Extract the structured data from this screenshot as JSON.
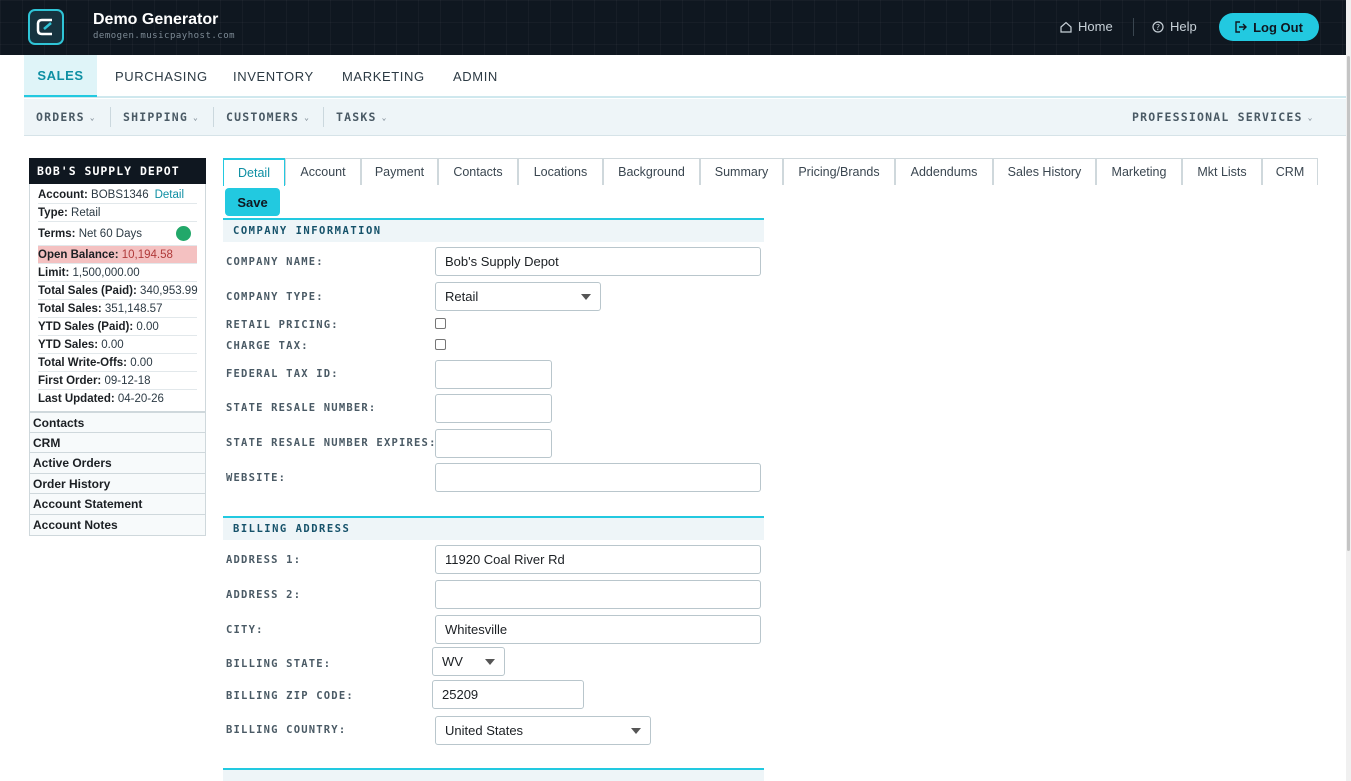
{
  "header": {
    "app_title": "Demo Generator",
    "app_subtitle": "demogen.musicpayhost.com",
    "home_label": "Home",
    "help_label": "Help",
    "logout_label": "Log Out"
  },
  "main_nav": {
    "tabs": [
      {
        "label": "SALES",
        "active": true
      },
      {
        "label": "PURCHASING"
      },
      {
        "label": "INVENTORY"
      },
      {
        "label": "MARKETING"
      },
      {
        "label": "ADMIN"
      }
    ]
  },
  "sub_nav": {
    "items": [
      {
        "label": "ORDERS"
      },
      {
        "label": "SHIPPING"
      },
      {
        "label": "CUSTOMERS"
      },
      {
        "label": "TASKS"
      }
    ],
    "right_label": "PROFESSIONAL SERVICES"
  },
  "account_panel": {
    "title": "BOB'S SUPPLY DEPOT",
    "account_label": "Account:",
    "account_value": "BOBS1346",
    "detail_link": "Detail",
    "type_label": "Type:",
    "type_value": "Retail",
    "terms_label": "Terms:",
    "terms_value": "Net 60 Days",
    "status_color": "#22a86a",
    "balance_label": "Open Balance:",
    "balance_value": "10,194.58",
    "limit_label": "Limit:",
    "limit_value": "1,500,000.00",
    "total_sales_paid_label": "Total Sales (Paid):",
    "total_sales_paid_value": "340,953.99",
    "total_sales_label": "Total Sales:",
    "total_sales_value": "351,148.57",
    "ytd_sales_paid_label": "YTD Sales (Paid):",
    "ytd_sales_paid_value": "0.00",
    "ytd_sales_label": "YTD Sales:",
    "ytd_sales_value": "0.00",
    "writeoffs_label": "Total Write-Offs:",
    "writeoffs_value": "0.00",
    "first_order_label": "First Order:",
    "first_order_value": "09-12-18",
    "last_updated_label": "Last Updated:",
    "last_updated_value": "04-20-26",
    "links": [
      "Contacts",
      "CRM",
      "Active Orders",
      "Order History",
      "Account Statement",
      "Account Notes"
    ]
  },
  "detail_tabs": [
    "Detail",
    "Account",
    "Payment",
    "Contacts",
    "Locations",
    "Background",
    "Summary",
    "Pricing/Brands",
    "Addendums",
    "Sales History",
    "Marketing",
    "Mkt Lists",
    "CRM"
  ],
  "save_label": "Save",
  "company_info": {
    "heading": "COMPANY INFORMATION",
    "company_name_label": "COMPANY NAME:",
    "company_name_value": "Bob's Supply Depot",
    "company_type_label": "COMPANY TYPE:",
    "company_type_value": "Retail",
    "retail_pricing_label": "RETAIL PRICING:",
    "charge_tax_label": "CHARGE TAX:",
    "federal_tax_label": "FEDERAL TAX ID:",
    "state_resale_label": "STATE RESALE NUMBER:",
    "state_resale_expires_label": "STATE RESALE NUMBER EXPIRES:",
    "website_label": "WEBSITE:"
  },
  "billing": {
    "heading": "BILLING ADDRESS",
    "address1_label": "ADDRESS 1:",
    "address1_value": "11920 Coal River Rd",
    "address2_label": "ADDRESS 2:",
    "city_label": "CITY:",
    "city_value": "Whitesville",
    "state_label": "BILLING STATE:",
    "state_value": "WV",
    "zip_label": "BILLING ZIP CODE:",
    "zip_value": "25209",
    "country_label": "BILLING COUNTRY:",
    "country_value": "United States"
  }
}
